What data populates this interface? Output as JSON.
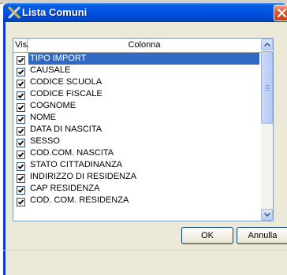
{
  "window": {
    "title": "Lista Comuni",
    "icon": "wrench-cross-icon",
    "close_icon": "close-icon"
  },
  "list": {
    "header_vis": "Vis.",
    "header_colonna": "Colonna",
    "selected_index": 0,
    "rows": [
      {
        "checked": true,
        "label": "TIPO IMPORT"
      },
      {
        "checked": true,
        "label": "CAUSALE"
      },
      {
        "checked": true,
        "label": "CODICE SCUOLA"
      },
      {
        "checked": true,
        "label": "CODICE FISCALE"
      },
      {
        "checked": true,
        "label": "COGNOME"
      },
      {
        "checked": true,
        "label": "NOME"
      },
      {
        "checked": true,
        "label": "DATA DI NASCITA"
      },
      {
        "checked": true,
        "label": "SESSO"
      },
      {
        "checked": true,
        "label": "COD.COM. NASCITA"
      },
      {
        "checked": true,
        "label": "STATO CITTADINANZA"
      },
      {
        "checked": true,
        "label": "INDIRIZZO DI RESIDENZA"
      },
      {
        "checked": true,
        "label": "CAP RESIDENZA"
      },
      {
        "checked": true,
        "label": "COD. COM. RESIDENZA"
      }
    ]
  },
  "buttons": {
    "ok": "OK",
    "annulla": "Annulla"
  },
  "colors": {
    "titlebar": "#0055e5",
    "selection": "#316ac5",
    "close_button": "#e05a30"
  }
}
